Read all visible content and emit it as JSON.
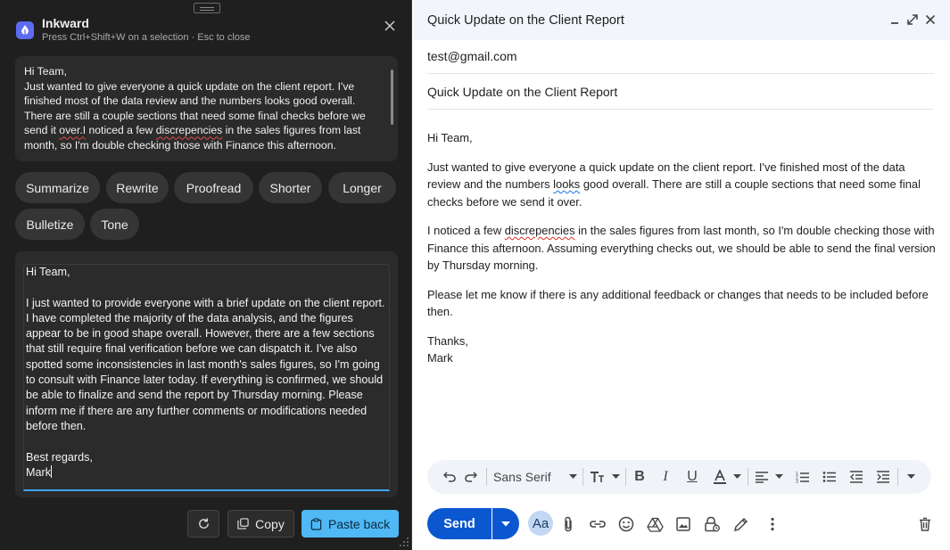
{
  "inkward": {
    "app_name": "Inkward",
    "hint": "Press Ctrl+Shift+W on a selection · Esc to close",
    "source": {
      "before": "Hi Team,\nJust wanted to give everyone a quick update on the client report. I've finished most of the data review and the numbers looks good overall. There are still a couple sections that need some final checks before we send it ",
      "squig1": "over.I",
      "middle": " noticed a few ",
      "squig2": "discrepencies",
      "after": " in the sales figures from last month, so I'm double checking those with Finance this afternoon."
    },
    "actions": [
      "Summarize",
      "Rewrite",
      "Proofread",
      "Shorter",
      "Longer",
      "Bulletize",
      "Tone"
    ],
    "result": "Hi Team,\n\nI just wanted to provide everyone with a brief update on the client report. I have completed the majority of the data analysis, and the figures appear to be in good shape overall. However, there are a few sections that still require final verification before we can dispatch it. I've also spotted some inconsistencies in last month's sales figures, so I'm going to consult with Finance later today. If everything is confirmed, we should be able to finalize and send the report by Thursday morning. Please inform me if there are any further comments or modifications needed before then.\n\nBest regards,\nMark",
    "copy_label": "Copy",
    "paste_label": "Paste back"
  },
  "compose": {
    "window_title": "Quick Update on the Client Report",
    "to": "test@gmail.com",
    "subject": "Quick Update on the Client Report",
    "body": {
      "greeting": "Hi Team,",
      "p1_a": "Just wanted to give everyone a quick update on the client report. I've finished most of the data review and the numbers ",
      "p1_b": "looks",
      "p1_c": " good overall. There are still a couple sections that need some final checks before we send it over.",
      "p2_a": "I noticed a few ",
      "p2_b": "discrepencies",
      "p2_c": " in the sales figures from last month, so I'm double checking those with Finance this afternoon. Assuming everything checks out, we should be able to send the final version by Thursday morning.",
      "p3": "Please let me know if there is any additional feedback or changes that needs to be included before then.",
      "closing": "Thanks,",
      "name": "Mark"
    },
    "font_name": "Sans Serif",
    "send_label": "Send",
    "format_button_label": "Aa"
  },
  "colors": {
    "panel_bg": "#1f1f1f",
    "accent_blue": "#4fb8f5",
    "send_blue": "#0b57d0"
  },
  "icons": [
    "inkward-logo-icon",
    "close-icon",
    "refresh-icon",
    "copy-icon",
    "paste-icon",
    "minimize-icon",
    "expand-icon",
    "undo-icon",
    "redo-icon",
    "text-size-icon",
    "bold-icon",
    "italic-icon",
    "underline-icon",
    "text-color-icon",
    "align-icon",
    "numbered-list-icon",
    "bullet-list-icon",
    "indent-less-icon",
    "indent-more-icon",
    "more-formatting-icon",
    "attach-icon",
    "link-icon",
    "emoji-icon",
    "drive-icon",
    "photo-icon",
    "confidential-icon",
    "signature-icon",
    "more-options-icon",
    "trash-icon"
  ]
}
